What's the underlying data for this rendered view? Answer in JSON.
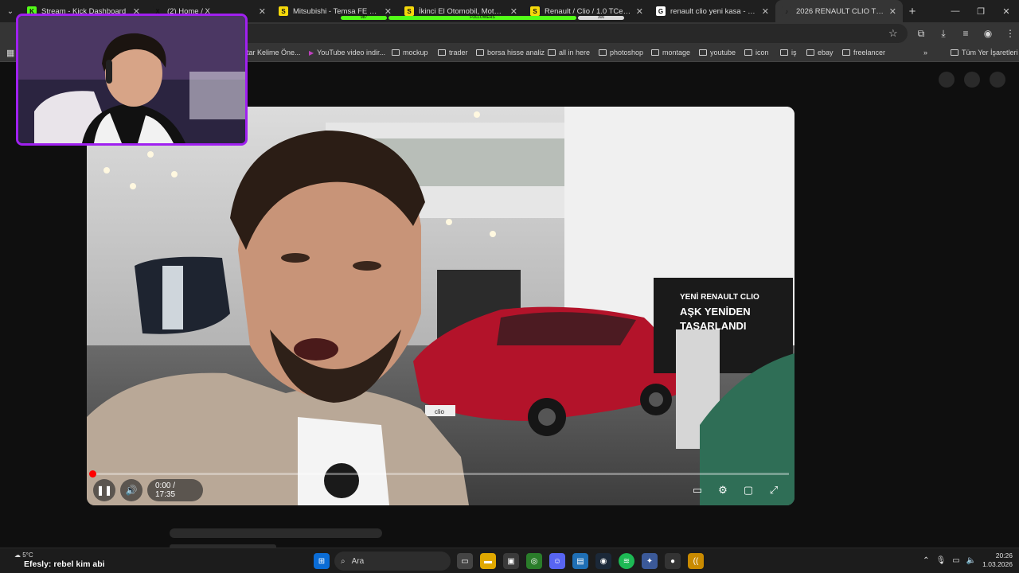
{
  "browser": {
    "tabs": [
      {
        "label": "Stream - Kick Dashboard",
        "favicon": "K",
        "fav_color": "#53fc18",
        "active": false
      },
      {
        "label": "(2) Home / X",
        "favicon": "X",
        "fav_color": "#1f1f1f",
        "active": false
      },
      {
        "label": "Mitsubishi - Temsa FE 304 Mo...",
        "favicon": "S",
        "fav_color": "#f5d90a",
        "active": false
      },
      {
        "label": "İkinci El Otomobil, Motosiklet...",
        "favicon": "S",
        "fav_color": "#f5d90a",
        "active": false
      },
      {
        "label": "Renault / Clio / 1.0 TCe / Techn...",
        "favicon": "S",
        "fav_color": "#f5d90a",
        "active": false
      },
      {
        "label": "renault clio yeni kasa - Google...",
        "favicon": "G",
        "fav_color": "#ffffff",
        "active": false
      },
      {
        "label": "2026 RENAULT CLIO TÜRKİ...",
        "favicon": "♪",
        "fav_color": "#353535",
        "active": true
      }
    ],
    "overlay_stats": {
      "left_value": "987",
      "followers_label": "FOLLOWERS",
      "right_value": "300"
    }
  },
  "bookmarks": [
    {
      "label": "ahtar Kelime Öne...",
      "icon": "page-icon"
    },
    {
      "label": "YouTube video indir...",
      "icon": "youtube-icon"
    },
    {
      "label": "mockup",
      "icon": "folder-icon"
    },
    {
      "label": "trader",
      "icon": "folder-icon"
    },
    {
      "label": "borsa hisse analiz",
      "icon": "folder-icon"
    },
    {
      "label": "all in here",
      "icon": "folder-icon"
    },
    {
      "label": "photoshop",
      "icon": "folder-icon"
    },
    {
      "label": "montage",
      "icon": "folder-icon"
    },
    {
      "label": "youtube",
      "icon": "folder-icon"
    },
    {
      "label": "icon",
      "icon": "folder-icon"
    },
    {
      "label": "iş",
      "icon": "folder-icon"
    },
    {
      "label": "ebay",
      "icon": "folder-icon"
    },
    {
      "label": "freelancer",
      "icon": "folder-icon"
    }
  ],
  "bookmarks_all": "Tüm Yer İşaretleri",
  "player": {
    "time": "0:00 / 17:35",
    "progress_fraction": 0.0,
    "sign_lines": [
      "YENİ RENAULT CLIO",
      "AŞK YENİDEN",
      "TASARLANDI"
    ],
    "plate_text": "clio"
  },
  "taskbar": {
    "weather_temp": "5°C",
    "chat_user": "Efesly:",
    "chat_message": "rebel kim abi",
    "search_label": "Ara",
    "time": "20:26",
    "date": "1.03.2026"
  }
}
